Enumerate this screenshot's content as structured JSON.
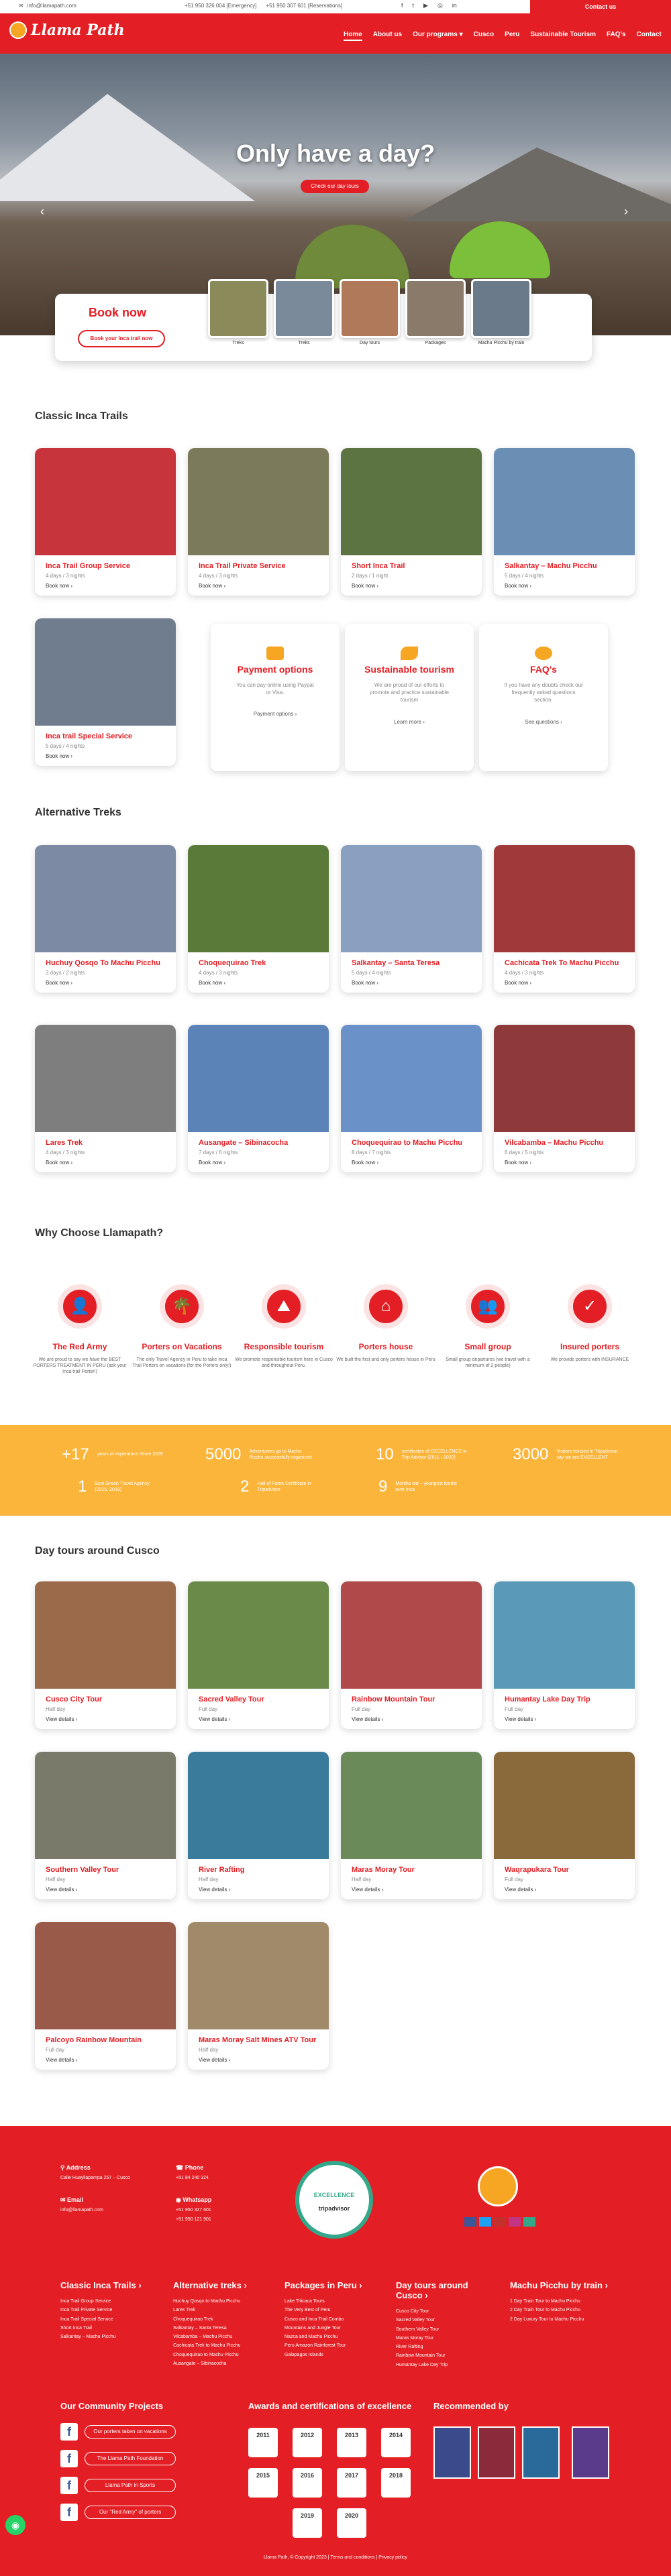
{
  "topbar": {
    "email": "info@llamapath.com",
    "phone1": "+51 950 326 004 [Emergency]",
    "phone2": "+51 950 307 601 [Reservations]",
    "contact": "Contact us",
    "social": [
      "f",
      "t",
      "▶",
      "◎",
      "in"
    ]
  },
  "nav": {
    "logo": "Llama Path",
    "items": [
      "Home",
      "About us",
      "Our programs ▾",
      "Cusco",
      "Peru",
      "Sustainable Tourism",
      "FAQ's",
      "Contact"
    ]
  },
  "hero": {
    "title": "Only have a day?",
    "cta": "Check our day tours"
  },
  "booking": {
    "title": "Book now",
    "button": "Book your Inca trail now",
    "thumbs": [
      "Treks",
      "Treks",
      "Day tours",
      "Packages",
      "Machu Picchu by train"
    ]
  },
  "sections": {
    "classic": "Classic Inca Trails",
    "alt": "Alternative Treks",
    "why": "Why Choose Llamapath?",
    "day": "Day tours around Cusco"
  },
  "classic": [
    {
      "title": "Inca Trail Group Service",
      "sub": "4 days / 3 nights",
      "link": "Book now ›",
      "color": "#c7343c"
    },
    {
      "title": "Inca Trail Private Service",
      "sub": "4 days / 3 nights",
      "link": "Book now ›",
      "color": "#7b7a5a"
    },
    {
      "title": "Short Inca Trail",
      "sub": "2 days / 1 night",
      "link": "Book now ›",
      "color": "#5c7442"
    },
    {
      "title": "Salkantay – Machu Picchu",
      "sub": "5 days / 4 nights",
      "link": "Book now ›",
      "color": "#6b8fb4"
    },
    {
      "title": "Inca trail Special Service",
      "sub": "5 days / 4 nights",
      "link": "Book now ›",
      "color": "#6f7d8e"
    }
  ],
  "info": [
    {
      "title": "Payment options",
      "desc": "You can pay online using Paypal or Visa.",
      "link": "Payment options ›"
    },
    {
      "title": "Sustainable tourism",
      "desc": "We are proud of our efforts to promote and practice sustainable tourism",
      "link": "Learn more ›"
    },
    {
      "title": "FAQ's",
      "desc": "If you have any doubts check our frequently asked questions section.",
      "link": "See questions ›"
    }
  ],
  "alt": [
    {
      "title": "Huchuy Qosqo To Machu Picchu",
      "sub": "3 days / 2 nights",
      "link": "Book now ›",
      "color": "#7c8aa4"
    },
    {
      "title": "Choquequirao Trek",
      "sub": "4 days / 3 nights",
      "link": "Book now ›",
      "color": "#5a7a3a"
    },
    {
      "title": "Salkantay – Santa Teresa",
      "sub": "5 days / 4 nights",
      "link": "Book now ›",
      "color": "#8aa0c0"
    },
    {
      "title": "Cachicata Trek To Machu Picchu",
      "sub": "4 days / 3 nights",
      "link": "Book now ›",
      "color": "#a03a3a"
    },
    {
      "title": "Lares Trek",
      "sub": "4 days / 3 nights",
      "link": "Book now ›",
      "color": "#7e7e7e"
    },
    {
      "title": "Ausangate – Sibinacocha",
      "sub": "7 days / 6 nights",
      "link": "Book now ›",
      "color": "#5b83b8"
    },
    {
      "title": "Choquequirao to Machu Picchu",
      "sub": "8 days / 7 nights",
      "link": "Book now ›",
      "color": "#6a92c8"
    },
    {
      "title": "Vilcabamba – Machu Picchu",
      "sub": "6 days / 5 nights",
      "link": "Book now ›",
      "color": "#8f3a3a"
    }
  ],
  "why": [
    {
      "title": "The Red Army",
      "desc": "We are proud to say we have the BEST PORTERS TREATMENT IN PERU (ask your Inca trail Porter!)",
      "icon": "👤"
    },
    {
      "title": "Porters on Vacations",
      "desc": "The only Travel Agency in Peru to take Inca Trail Porters on vacations (for the Porters only!)",
      "icon": "🌴"
    },
    {
      "title": "Responsible tourism",
      "desc": "We promote responsible tourism here in Cusco and throughout Peru.",
      "icon": "⛰"
    },
    {
      "title": "Porters house",
      "desc": "We built the first and only porters house in Peru",
      "icon": "⌂"
    },
    {
      "title": "Small group",
      "desc": "Small group departures (we travel with a minimum of 2 people)",
      "icon": "👥"
    },
    {
      "title": "Insured porters",
      "desc": "We provide porters with INSURANCE",
      "icon": "✓"
    }
  ],
  "stats": [
    {
      "n": "+17",
      "l": "years of experience Since 2005"
    },
    {
      "n": "5000",
      "l": "Adventurers go to Machu Picchu successfully organized"
    },
    {
      "n": "10",
      "l": "certificates of EXCELLENCE in Trip Advisor (2011 - 2020)"
    },
    {
      "n": "3000",
      "l": "Visitors housed in Tripadvisor say we are EXCELLENT"
    },
    {
      "n": "1",
      "l": "Best Green Travel Agency (2015, 2019)"
    },
    {
      "n": "2",
      "l": "Hall of Fame Certificate in Tripadvisor"
    },
    {
      "n": "9",
      "l": "Months old – youngest tourist ever Inca"
    }
  ],
  "day": [
    {
      "title": "Cusco City Tour",
      "sub": "Half day",
      "link": "View details ›",
      "color": "#9a6a4a"
    },
    {
      "title": "Sacred Valley Tour",
      "sub": "Full day",
      "link": "View details ›",
      "color": "#6a8a4a"
    },
    {
      "title": "Rainbow Mountain Tour",
      "sub": "Full day",
      "link": "View details ›",
      "color": "#b04a4a"
    },
    {
      "title": "Humantay Lake Day Trip",
      "sub": "Full day",
      "link": "View details ›",
      "color": "#5a9ab8"
    },
    {
      "title": "Southern Valley Tour",
      "sub": "Half day",
      "link": "View details ›",
      "color": "#7a7a6a"
    },
    {
      "title": "River Rafting",
      "sub": "Half day",
      "link": "View details ›",
      "color": "#3a7a9a"
    },
    {
      "title": "Maras Moray Tour",
      "sub": "Half day",
      "link": "View details ›",
      "color": "#6a8a5a"
    },
    {
      "title": "Waqrapukara Tour",
      "sub": "Full day",
      "link": "View details ›",
      "color": "#8a6a3a"
    },
    {
      "title": "Palcoyo Rainbow Mountain",
      "sub": "Full day",
      "link": "View details ›",
      "color": "#9a5a4a"
    },
    {
      "title": "Maras Moray Salt Mines ATV Tour",
      "sub": "Half day",
      "link": "View details ›",
      "color": "#a08a6a"
    }
  ],
  "footer": {
    "address_h": "Address",
    "address": "Calle Huayllapampa 257 – Cusco",
    "phone_h": "Phone",
    "phone": "+51 84 240 324",
    "email_h": "Email",
    "email": "info@llamapath.com",
    "wa_h": "Whatsapp",
    "wa1": "+51 950 327 601",
    "wa2": "+51 950 121 901",
    "ta": "EXCELLENCE",
    "ta2": "tripadvisor",
    "cols": [
      {
        "h": "Classic Inca Trails ›",
        "items": [
          "Inca Trail Group Service",
          "Inca Trail Private Service",
          "Inca Trail Special Service",
          "Short Inca Trail",
          "Salkantay – Machu Picchu"
        ]
      },
      {
        "h": "Alternative treks ›",
        "items": [
          "Huchuy Qosqo to Machu Picchu",
          "Lares Trek",
          "Choquequirao Trek",
          "Salkantay – Santa Teresa",
          "Vilcabamba – Machu Picchu",
          "Cachicata Trek to Machu Picchu",
          "Choquequirao to Machu Picchu",
          "Ausangate – Sibinacocha"
        ]
      },
      {
        "h": "Packages in Peru ›",
        "items": [
          "Lake Titicaca Tours",
          "The Very Best of Peru",
          "Cusco and Inca Trail Combo",
          "Mountains and Jungle Tour",
          "Nazca and Machu Picchu",
          "Peru Amazon Rainforest Tour",
          "Galapagos Islands"
        ]
      },
      {
        "h": "Day tours around Cusco ›",
        "items": [
          "Cusco City Tour",
          "Sacred Valley Tour",
          "Southern Valley Tour",
          "Maras Moray Tour",
          "River Rafting",
          "Rainbow Mountain Tour",
          "Humantay Lake Day Trip"
        ]
      },
      {
        "h": "Machu Picchu by train ›",
        "items": [
          "1 Day Train Tour to Machu Picchu",
          "2 Day Train Tour to Machu Picchu",
          "2 Day Luxury Tour to Machu Picchu"
        ]
      }
    ],
    "community_h": "Our Community Projects",
    "community": [
      "Our porters taken on vacations",
      "The Llama Path Foundation",
      "Llama Path in Sports",
      "Our \"Red Army\" of porters"
    ],
    "awards_h": "Awards and certifications of excellence",
    "awards": [
      "2011",
      "2012",
      "2013",
      "2014",
      "2015",
      "2016",
      "2017",
      "2018",
      "2019",
      "2020"
    ],
    "rec_h": "Recommended by",
    "copyright": "Llama Path, © Copyright 2023 | Terms and conditions | Privacy policy"
  }
}
